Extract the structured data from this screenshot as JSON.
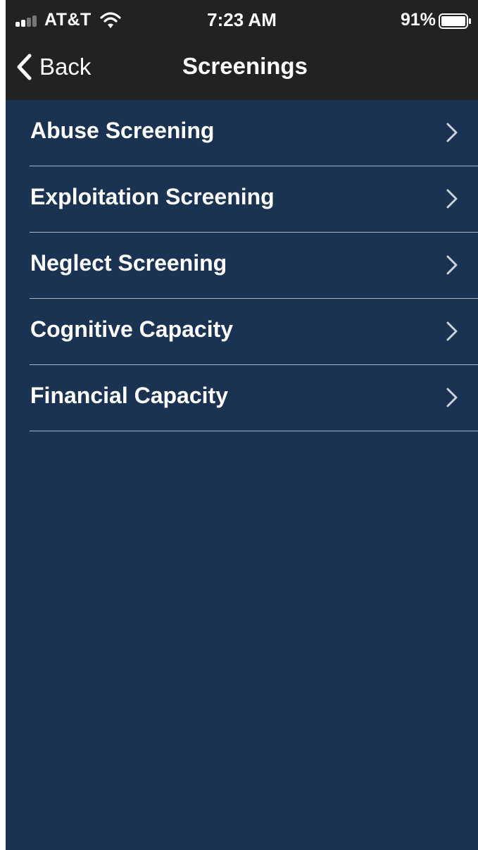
{
  "status_bar": {
    "carrier": "AT&T",
    "time": "7:23 AM",
    "battery_percent": "91%",
    "icons": [
      "signal-icon",
      "wifi-icon",
      "battery-icon"
    ]
  },
  "nav_bar": {
    "back_label": "Back",
    "title": "Screenings",
    "back_icon": "chevron-left-icon"
  },
  "list": {
    "items": [
      {
        "label": "Abuse Screening"
      },
      {
        "label": "Exploitation Screening"
      },
      {
        "label": "Neglect Screening"
      },
      {
        "label": "Cognitive Capacity"
      },
      {
        "label": "Financial Capacity"
      }
    ],
    "item_icon": "chevron-right-icon"
  },
  "colors": {
    "background": "#1a3352",
    "header": "#222222",
    "text": "#ffffff",
    "separator": "#a9b5c4"
  }
}
